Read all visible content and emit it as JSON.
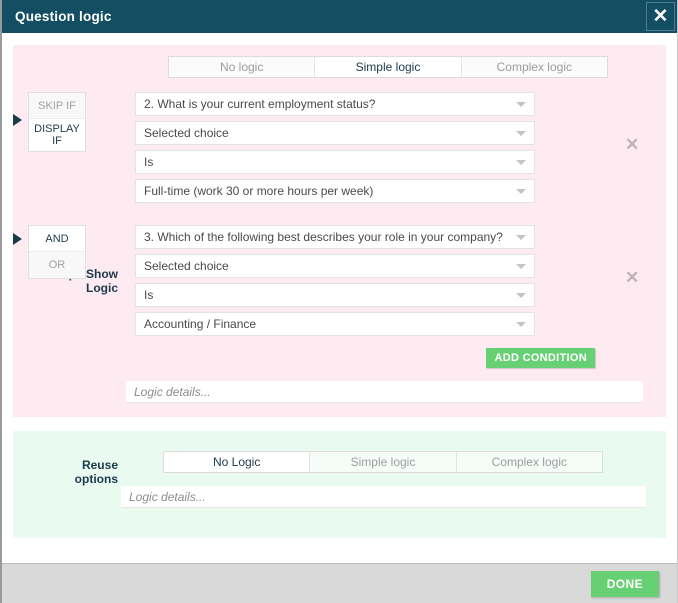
{
  "titlebar": {
    "title": "Question logic",
    "close_label": "✕"
  },
  "skip_show": {
    "label_line1": "Skip / Show",
    "label_line2": "Logic",
    "tabs": [
      {
        "label": "No logic",
        "active": false
      },
      {
        "label": "Simple logic",
        "active": true
      },
      {
        "label": "Complex logic",
        "active": false
      }
    ],
    "conditions": [
      {
        "toggles": [
          {
            "label": "SKIP IF",
            "active": false
          },
          {
            "label": "DISPLAY IF",
            "active": true
          }
        ],
        "fields": [
          {
            "value": "2. What is your current employment status?"
          },
          {
            "value": "Selected choice"
          },
          {
            "value": "Is"
          },
          {
            "value": "Full-time (work 30 or more hours per week)"
          }
        ],
        "delete_label": "✕"
      },
      {
        "toggles": [
          {
            "label": "AND",
            "active": true
          },
          {
            "label": "OR",
            "active": false
          }
        ],
        "fields": [
          {
            "value": "3. Which of the following best describes your role in your company?"
          },
          {
            "value": "Selected choice"
          },
          {
            "value": "Is"
          },
          {
            "value": "Accounting / Finance"
          }
        ],
        "delete_label": "✕"
      }
    ],
    "add_condition_label": "ADD CONDITION",
    "details_placeholder": "Logic details...",
    "details_value": ""
  },
  "reuse": {
    "label_line1": "Reuse",
    "label_line2": "options",
    "tabs": [
      {
        "label": "No Logic",
        "active": true
      },
      {
        "label": "Simple logic",
        "active": false
      },
      {
        "label": "Complex logic",
        "active": false
      }
    ],
    "details_placeholder": "Logic details...",
    "details_value": ""
  },
  "footer": {
    "done_label": "DONE"
  },
  "colors": {
    "titlebar": "#134e63",
    "pink_section": "#fdebf1",
    "green_section": "#e9fbf0",
    "accent_green": "#68d074",
    "footer": "#d9d9d9",
    "text_dark": "#1b3a4b"
  }
}
